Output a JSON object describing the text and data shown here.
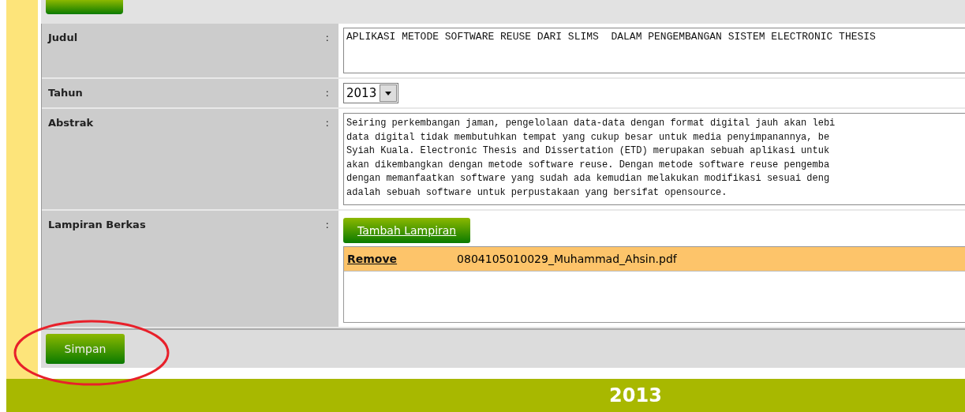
{
  "form": {
    "rows": [
      {
        "kind": "text",
        "label": "Judul",
        "separator": ":",
        "value": "APLIKASI METODE SOFTWARE REUSE DARI SLIMS  DALAM PENGEMBANGAN SISTEM ELECTRONIC THESIS"
      },
      {
        "kind": "select",
        "label": "Tahun",
        "separator": ":",
        "value": "2013"
      },
      {
        "kind": "textarea",
        "label": "Abstrak",
        "separator": ":",
        "lines": [
          "Seiring perkembangan jaman, pengelolaan data-data dengan format digital jauh akan lebi",
          "data digital tidak membutuhkan tempat yang cukup besar untuk media penyimpanannya, be",
          "Syiah Kuala. Electronic Thesis and Dissertation (ETD) merupakan sebuah aplikasi untuk",
          "akan dikembangkan dengan metode software reuse. Dengan metode software reuse pengemba",
          "dengan memanfaatkan software yang sudah ada kemudian melakukan modifikasi sesuai deng",
          "adalah sebuah software untuk perpustakaan yang bersifat opensource."
        ]
      },
      {
        "kind": "attachments",
        "label": "Lampiran Berkas",
        "separator": ":",
        "add_button": "Tambah Lampiran",
        "files": [
          {
            "remove": "Remove",
            "name": "0804105010029_Muhammad_Ahsin.pdf"
          }
        ]
      }
    ]
  },
  "save_button": "Simpan",
  "footer": {
    "text": "2013"
  }
}
